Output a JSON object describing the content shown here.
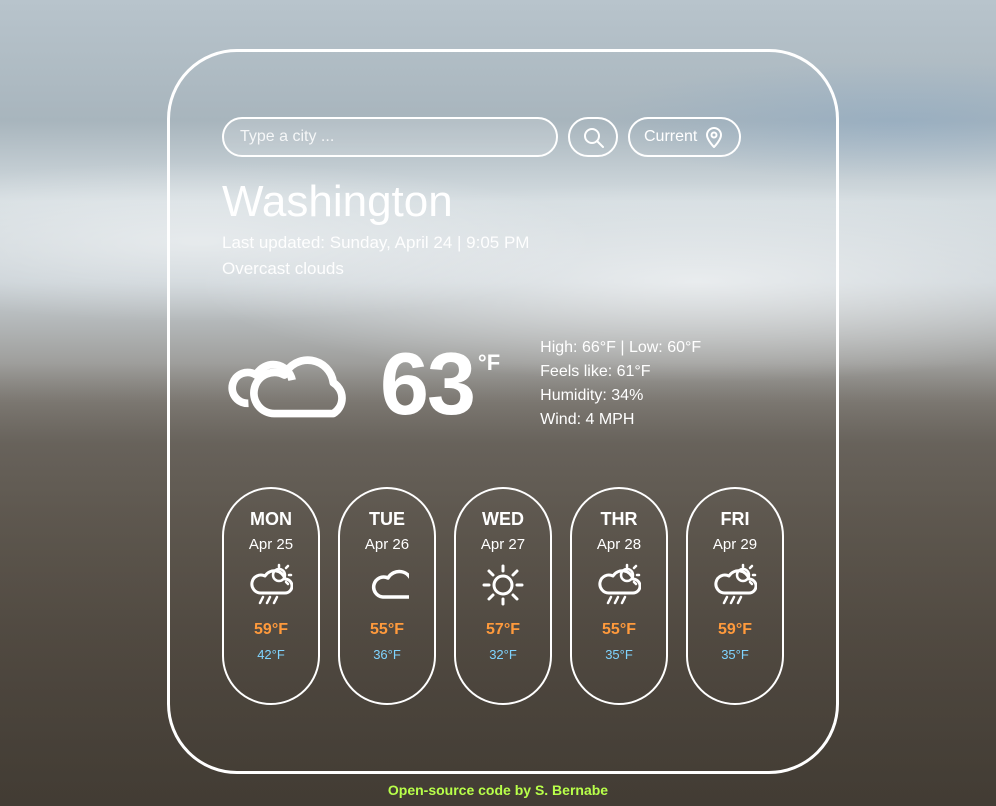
{
  "search": {
    "placeholder": "Type a city ..."
  },
  "current_button": {
    "label": "Current"
  },
  "location": {
    "city": "Washington",
    "updated": "Last updated: Sunday, April 24 | 9:05 PM",
    "condition": "Overcast clouds"
  },
  "current": {
    "temp": "63",
    "unit": "°F",
    "high_low": "High: 66°F | Low: 60°F",
    "feels_like": "Feels like: 61°F",
    "humidity": "Humidity: 34%",
    "wind": "Wind: 4 MPH",
    "icon": "cloud"
  },
  "forecast": [
    {
      "day": "MON",
      "date": "Apr 25",
      "icon": "rain-sun",
      "high": "59°F",
      "low": "42°F"
    },
    {
      "day": "TUE",
      "date": "Apr 26",
      "icon": "cloud",
      "high": "55°F",
      "low": "36°F"
    },
    {
      "day": "WED",
      "date": "Apr 27",
      "icon": "sun",
      "high": "57°F",
      "low": "32°F"
    },
    {
      "day": "THR",
      "date": "Apr 28",
      "icon": "rain-sun",
      "high": "55°F",
      "low": "35°F"
    },
    {
      "day": "FRI",
      "date": "Apr 29",
      "icon": "rain-sun",
      "high": "59°F",
      "low": "35°F"
    }
  ],
  "footer": "Open-source code by S. Bernabe"
}
